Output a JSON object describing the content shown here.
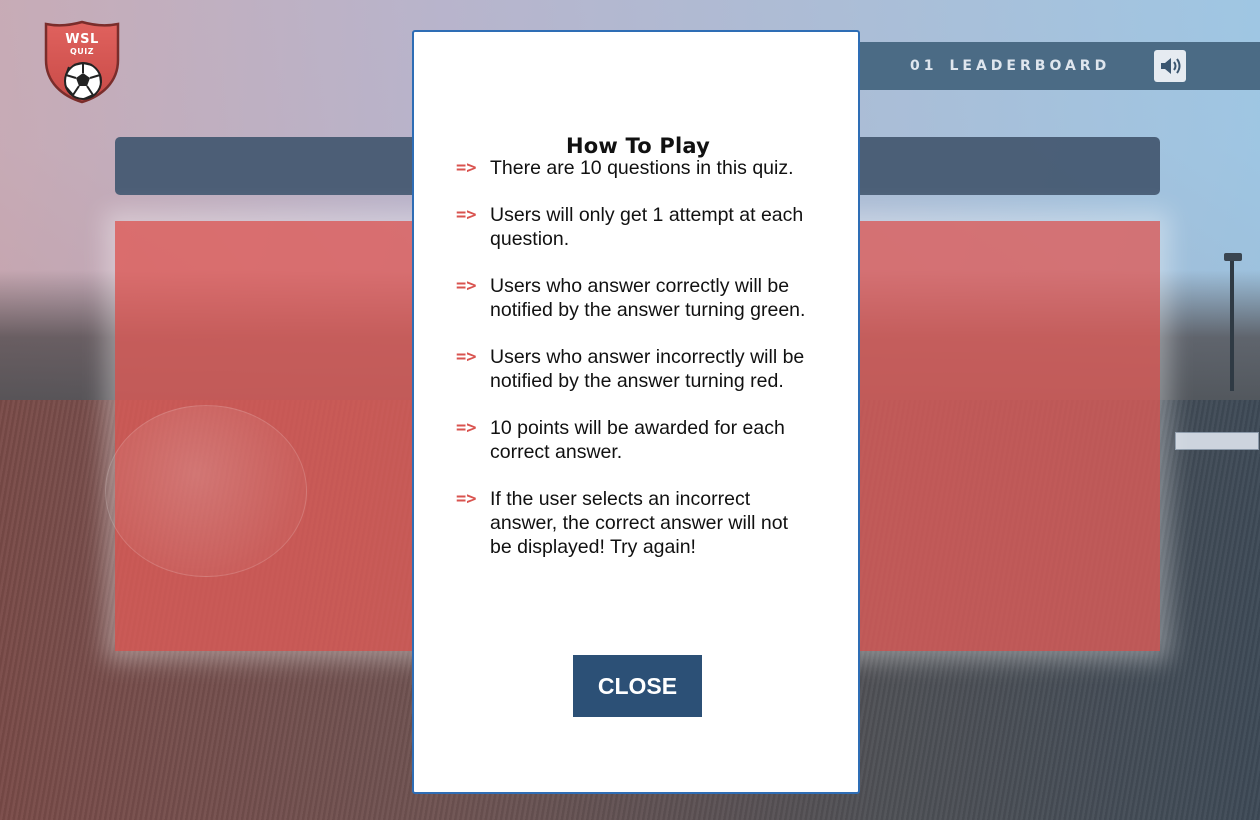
{
  "logo": {
    "line1": "WSL",
    "line2": "QUIZ"
  },
  "topnav": {
    "score": "01",
    "leaderboard_label": "LEADERBOARD"
  },
  "modal": {
    "title": "How To Play",
    "arrow": "=>",
    "rules": [
      "There are 10 questions in this quiz.",
      "Users will only get 1 attempt at each question.",
      "Users who answer correctly will be notified by the answer turning green.",
      "Users who answer incorrectly will be notified by the answer turning red.",
      "10 points will be awarded for each correct answer.",
      "If the user selects an incorrect answer, the correct answer will not be displayed! Try again!"
    ],
    "close_label": "CLOSE"
  },
  "colors": {
    "modal_border": "#2e6db5",
    "close_button": "#2c5076",
    "arrow": "#d9534f",
    "nav_bar": "#4b6b85",
    "answers_panel": "#e05c58"
  },
  "icons": {
    "sound": "speaker-icon",
    "logo": "soccer-ball-shield-icon"
  }
}
